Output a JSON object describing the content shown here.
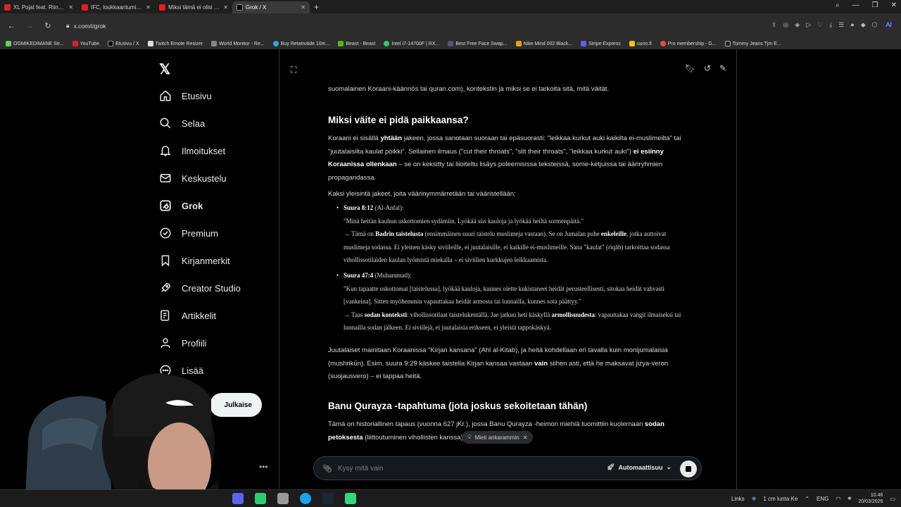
{
  "browser": {
    "tabs": [
      {
        "label": "XL Pojat feat. Riina ja Joni",
        "active": false
      },
      {
        "label": "IFC, loukkaantuminen & V",
        "active": false
      },
      {
        "label": "Miksi tämä ei olisi Patrik L",
        "active": false
      },
      {
        "label": "Grok / X",
        "active": true
      }
    ],
    "url": "x.com/i/grok",
    "bookmarks": [
      "OGMIKEDIMANE Str...",
      "YouTube",
      "Etusivu / X",
      "Twitch Emote Resizer",
      "World Monitor - Re...",
      "Buy Retatrutide 10m...",
      "Beast - Beast",
      "Intel i7-14700F | RX...",
      "Best Free Face Swap...",
      "Nike Mind 002 Black...",
      "Stripe Express",
      "uuno.fi",
      "Pro membership - G...",
      "Tommy Jeans Tjm E..."
    ],
    "ai_label": "AI"
  },
  "sidebar": {
    "items": [
      {
        "label": "Etusivu",
        "icon": "home-icon"
      },
      {
        "label": "Selaa",
        "icon": "search-icon"
      },
      {
        "label": "Ilmoitukset",
        "icon": "bell-icon"
      },
      {
        "label": "Keskustelu",
        "icon": "mail-icon"
      },
      {
        "label": "Grok",
        "icon": "grok-icon"
      },
      {
        "label": "Premium",
        "icon": "verified-icon"
      },
      {
        "label": "Kirjanmerkit",
        "icon": "bookmark-icon"
      },
      {
        "label": "Creator Studio",
        "icon": "rocket-icon"
      },
      {
        "label": "Artikkelit",
        "icon": "article-icon"
      },
      {
        "label": "Profiili",
        "icon": "user-icon"
      },
      {
        "label": "Lisää",
        "icon": "more-icon"
      }
    ],
    "post_label": "Julkaise"
  },
  "content": {
    "intro_line": "suomalainen Koraani-käännös tai quran.com), kontekstin ja miksi se ei tarkoita sitä, mitä väität.",
    "heading1": "Miksi väite ei pidä paikkaansa?",
    "para1_a": "Koraani ei sisällä ",
    "para1_b": "yhtään",
    "para1_c": " jakeen, jossa sanotaan suoraan tai epäsuorasti: \"leikkaa kurkut auki kaikilta ei-muslimeilta\" tai \"juutalaisilta kaulat poikki\". Sellainen ilmaus (\"cut their throats\", \"slit their throats\", \"leikkaa kurkut auki\") ",
    "para1_d": "ei esiinny Koraanissa ollenkaan",
    "para1_e": " – se on keksitty tai liioiteltu lisäys poleemisissa teksteissä, some-ketjuissa tai ääriryhmien propagandassa.",
    "para2": "Kaksi yleisintä jakeet, joita väärinymmärretään tai vääristellään:",
    "bullet1": {
      "title": "Suura 8:12",
      "sub": " (Al-Anfal):",
      "quote": "\"Minä heitän kauhun uskottomien sydämiin. Lyökää siis kauloja ja lyökää heiltä sormenpäitä.\"",
      "arrow_a": "→ Tämä on ",
      "arrow_b": "Badrin taistelusta",
      "arrow_c": " (ensimmäinen suuri taistelu muslimeja vastaan). Se on Jumalan puhe ",
      "arrow_d": "enkeleille",
      "arrow_e": ", jotka auttoivat muslimeja sodassa. Ei yleinen käsky siviileille, ei juutalaisille, ei kaikille ei-muslimeille. Sana \"kaulat\" (riqāb) tarkoittaa sodassa vihollissotilaiden kaulan lyömistä miekalla – ei siviilien kurkkujen leikkaamista."
    },
    "bullet2": {
      "title": "Suura 47:4",
      "sub": " (Muhammad):",
      "quote": "\"Kun tapaatte uskottomat [taistelussa], lyökää kauloja, kunnes olette kukistaneet heidät perusteellisesti, sitokaa heidät vahvasti [vankeina]. Sitten myöhemmin vapauttakaa heidät armosta tai lunnailla, kunnes sota päättyy.\"",
      "arrow_a": "→ Taas ",
      "arrow_b": "sodan konteksti",
      "arrow_c": ": vihollissotilaat taistelukentällä. Jae jatkuu heti käskyllä ",
      "arrow_d": "armollisuudesta",
      "arrow_e": ": vapauttakaa vangit ilmaiseksi tai lunnailla sodan jälkeen. Ei siviilejä, ei juutalaisia erikseen, ei yleistä tappokäskyä."
    },
    "para3_a": "Juutalaiset mainitaan Koraanissa \"Kirjan kansana\" (Ahl al-Kitab), ja heitä kohdellaan eri tavalla kuin monijumalaisia (mushrikūn). Esim. suura 9:29 käskee taistella Kirjan kansaa vastaan ",
    "para3_b": "vain",
    "para3_c": " siihen asti, että he maksavat jizya-veron (suojausvero) – ei tappaa heitä.",
    "heading2": "Banu Qurayza -tapahtuma (jota joskus sekoitetaan tähän)",
    "para4_a": "Tämä on historiallinen tapaus (vuonna 627 jKr.), jossa Banu Qurayza -heimon miehiä tuomittiin kuolemaan ",
    "para4_b": "sodan petoksesta",
    "para4_c": " (liittoutuminen vihollisten kanssa)."
  },
  "think_pill": "Mieti ankarammin",
  "composer": {
    "placeholder": "Kysy mitä vain",
    "mode_label": "Automaattisuu"
  },
  "taskbar": {
    "links_label": "Links",
    "weather": "1 cm lunta Ke",
    "lang": "ENG",
    "time": "10.46",
    "date": "20/03/2026"
  }
}
